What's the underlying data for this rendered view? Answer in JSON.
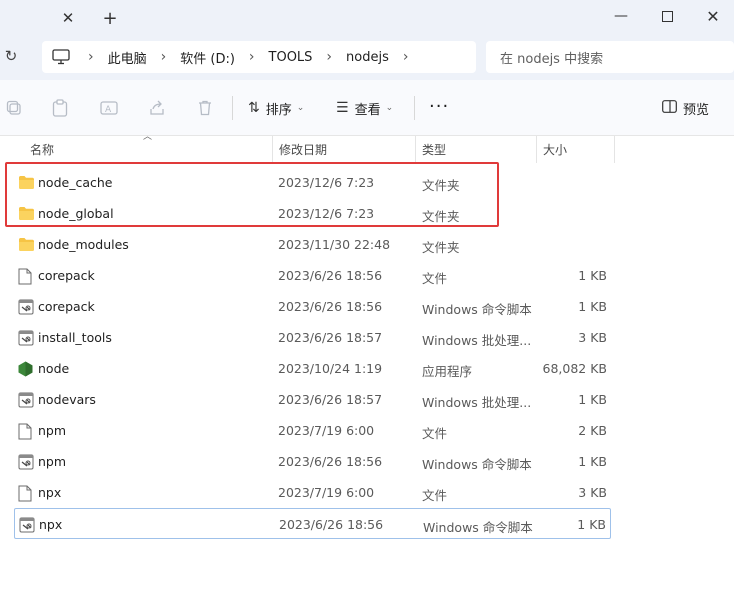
{
  "breadcrumb": [
    "此电脑",
    "软件 (D:)",
    "TOOLS",
    "nodejs"
  ],
  "search": {
    "placeholder": "在 nodejs 中搜索"
  },
  "toolbar": {
    "sort_label": "排序",
    "view_label": "查看",
    "more_label": "···",
    "preview_label": "预览"
  },
  "columns": {
    "name": "名称",
    "date": "修改日期",
    "type": "类型",
    "size": "大小"
  },
  "files": [
    {
      "name": "node_cache",
      "date": "2023/12/6 7:23",
      "type": "文件夹",
      "size": "",
      "icon": "folder-icon"
    },
    {
      "name": "node_global",
      "date": "2023/12/6 7:23",
      "type": "文件夹",
      "size": "",
      "icon": "folder-icon"
    },
    {
      "name": "node_modules",
      "date": "2023/11/30 22:48",
      "type": "文件夹",
      "size": "",
      "icon": "folder-icon"
    },
    {
      "name": "corepack",
      "date": "2023/6/26 18:56",
      "type": "文件",
      "size": "1 KB",
      "icon": "file-icon"
    },
    {
      "name": "corepack",
      "date": "2023/6/26 18:56",
      "type": "Windows 命令脚本",
      "size": "1 KB",
      "icon": "script-icon"
    },
    {
      "name": "install_tools",
      "date": "2023/6/26 18:57",
      "type": "Windows 批处理...",
      "size": "3 KB",
      "icon": "script-icon"
    },
    {
      "name": "node",
      "date": "2023/10/24 1:19",
      "type": "应用程序",
      "size": "68,082 KB",
      "icon": "nodejs-icon"
    },
    {
      "name": "nodevars",
      "date": "2023/6/26 18:57",
      "type": "Windows 批处理...",
      "size": "1 KB",
      "icon": "script-icon"
    },
    {
      "name": "npm",
      "date": "2023/7/19 6:00",
      "type": "文件",
      "size": "2 KB",
      "icon": "file-icon"
    },
    {
      "name": "npm",
      "date": "2023/6/26 18:56",
      "type": "Windows 命令脚本",
      "size": "1 KB",
      "icon": "script-icon"
    },
    {
      "name": "npx",
      "date": "2023/7/19 6:00",
      "type": "文件",
      "size": "3 KB",
      "icon": "file-icon"
    },
    {
      "name": "npx",
      "date": "2023/6/26 18:56",
      "type": "Windows 命令脚本",
      "size": "1 KB",
      "icon": "script-icon"
    }
  ],
  "colors": {
    "highlight": "#e03a3a",
    "folder": "#f6c445",
    "nodejs": "#3c873a",
    "focus": "#9fc1ea"
  }
}
